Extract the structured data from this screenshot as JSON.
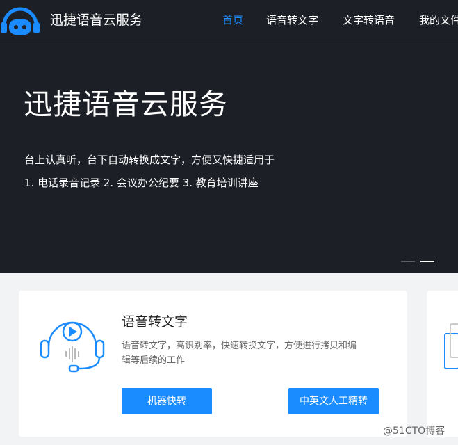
{
  "header": {
    "brand": "迅捷语音云服务",
    "logo_icon": "headset-robot-icon",
    "nav": [
      {
        "label": "首页",
        "active": true
      },
      {
        "label": "语音转文字",
        "active": false
      },
      {
        "label": "文字转语音",
        "active": false
      },
      {
        "label": "我的文件",
        "active": false
      }
    ]
  },
  "hero": {
    "title": "迅捷语音云服务",
    "description": "台上认真听，台下自动转换成文字，方便又快捷适用于",
    "use_cases": "1. 电话录音记录  2. 会议办公纪要  3. 教育培训讲座",
    "carousel_active_index": 1
  },
  "cards": [
    {
      "title": "语音转文字",
      "description": "语音转文字，高识别率，快速转换文字，方便进行拷贝和编辑等后续的工作",
      "icon": "headset-audio-icon",
      "buttons": [
        "机器快转",
        "中英文人工精转"
      ]
    }
  ],
  "watermark": "@51CTO博客",
  "colors": {
    "accent": "#1b8cff",
    "hero_bg": "#1d1f27",
    "page_bg": "#f2f3f5"
  }
}
